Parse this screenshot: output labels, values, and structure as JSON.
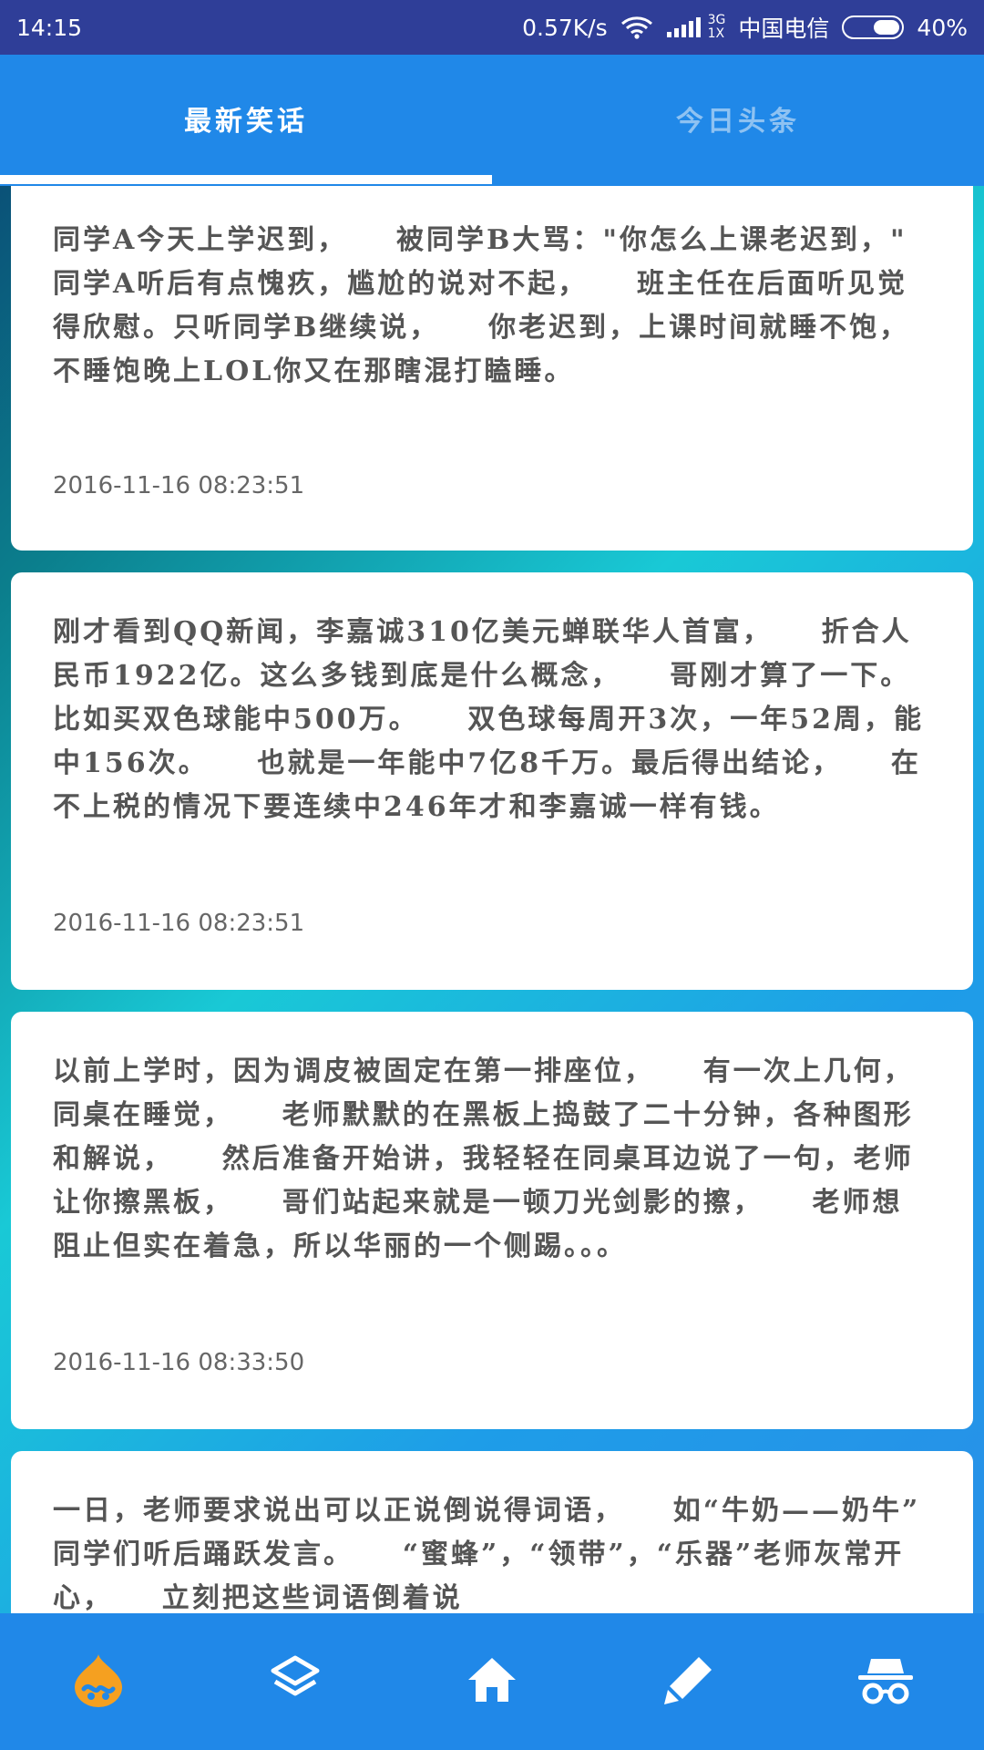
{
  "status_bar": {
    "time": "14:15",
    "network_speed": "0.57K/s",
    "network_type_top": "3G",
    "network_type_bottom": "1X",
    "carrier": "中国电信",
    "battery": "40%"
  },
  "tabs": [
    {
      "label": "最新笑话",
      "active": true
    },
    {
      "label": "今日头条",
      "active": false
    }
  ],
  "jokes": [
    {
      "text": "同学A今天上学迟到，    被同学B大骂：\"你怎么上课老迟到，\"    同学A听后有点愧疚，尴尬的说对不起，    班主任在后面听见觉得欣慰。只听同学B继续说，    你老迟到，上课时间就睡不饱，    不睡饱晚上LOL你又在那瞎混打瞌睡。",
      "date": "2016-11-16 08:23:51"
    },
    {
      "text": "刚才看到QQ新闻，李嘉诚310亿美元蝉联华人首富，    折合人民币1922亿。这么多钱到底是什么概念，    哥刚才算了一下。比如买双色球能中500万。    双色球每周开3次，一年52周，能中156次。    也就是一年能中7亿8千万。最后得出结论，    在不上税的情况下要连续中246年才和李嘉诚一样有钱。",
      "date": "2016-11-16 08:23:51"
    },
    {
      "text": "以前上学时，因为调皮被固定在第一排座位，    有一次上几何，同桌在睡觉，    老师默默的在黑板上捣鼓了二十分钟，各种图形和解说，    然后准备开始讲，我轻轻在同桌耳边说了一句，老师让你擦黑板，    哥们站起来就是一顿刀光剑影的擦，    老师想阻止但实在着急，所以华丽的一个侧踢。。。",
      "date": "2016-11-16 08:33:50"
    },
    {
      "text": "一日，老师要求说出可以正说倒说得词语，    如“牛奶——奶牛” 同学们听后踊跃发言。    “蜜蜂”，“领带”，“乐器”老师灰常开心，    立刻把这些词语倒着说",
      "date": ""
    }
  ],
  "bottom_nav": [
    {
      "icon": "drupal-icon",
      "active": true
    },
    {
      "icon": "layers-icon",
      "active": false
    },
    {
      "icon": "home-icon",
      "active": false
    },
    {
      "icon": "pencil-icon",
      "active": false
    },
    {
      "icon": "incognito-icon",
      "active": false
    }
  ],
  "colors": {
    "status_bar": "#2f3e98",
    "primary": "#2088e8",
    "active_tab_text": "#ffffff",
    "inactive_tab_text": "#8ec2f2",
    "accent_orange": "#f5a020",
    "card_text": "#555555"
  }
}
